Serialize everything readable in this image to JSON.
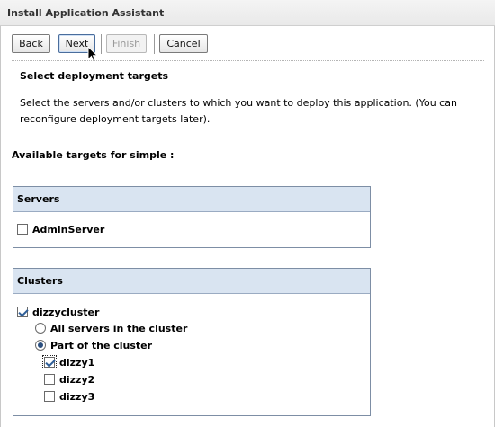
{
  "window": {
    "title": "Install Application Assistant"
  },
  "toolbar": {
    "back_label": "Back",
    "next_label": "Next",
    "finish_label": "Finish",
    "cancel_label": "Cancel"
  },
  "page": {
    "heading": "Select deployment targets",
    "description": "Select the servers and/or clusters to which you want to deploy this application. (You can reconfigure deployment targets later).",
    "available_label": "Available targets for simple :"
  },
  "servers": {
    "header": "Servers",
    "items": [
      {
        "label": "AdminServer",
        "checked": false
      }
    ]
  },
  "clusters": {
    "header": "Clusters",
    "cluster": {
      "label": "dizzycluster",
      "checked": true
    },
    "options": [
      {
        "label": "All servers in the cluster",
        "selected": false
      },
      {
        "label": "Part of the cluster",
        "selected": true
      }
    ],
    "members": [
      {
        "label": "dizzy1",
        "checked": true
      },
      {
        "label": "dizzy2",
        "checked": false
      },
      {
        "label": "dizzy3",
        "checked": false
      }
    ]
  },
  "colors": {
    "panel_header_bg": "#d9e4f1",
    "panel_border": "#7d8ea5",
    "check_mark": "#2f5f98"
  }
}
